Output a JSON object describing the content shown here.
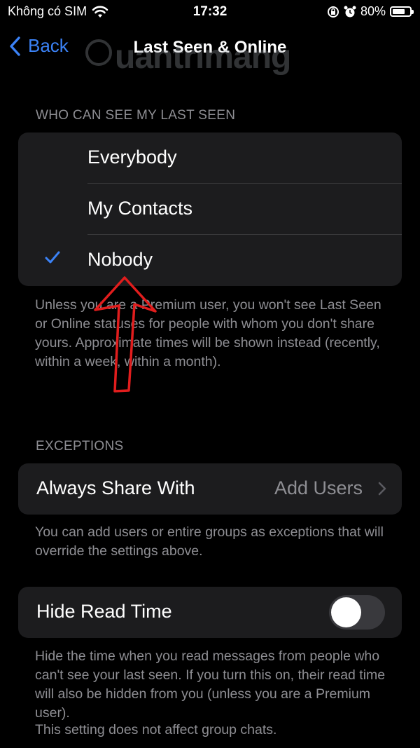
{
  "status_bar": {
    "carrier": "Không có SIM",
    "time": "17:32",
    "battery_percent": "80%",
    "battery_level": 0.8,
    "icons": [
      "wifi-icon",
      "orientation-lock-icon",
      "alarm-icon",
      "battery-icon"
    ]
  },
  "nav": {
    "back_label": "Back",
    "title": "Last Seen & Online"
  },
  "watermark": {
    "text": "uantrimang"
  },
  "last_seen": {
    "header": "WHO CAN SEE MY LAST SEEN",
    "options": [
      {
        "label": "Everybody",
        "selected": false
      },
      {
        "label": "My Contacts",
        "selected": false
      },
      {
        "label": "Nobody",
        "selected": true
      }
    ],
    "footer": "Unless you are a Premium user, you won't see Last Seen or Online statuses for people with whom you don't share yours. Approximate times will be shown instead (recently, within a week, within a month)."
  },
  "exceptions": {
    "header": "EXCEPTIONS",
    "row_label": "Always Share With",
    "row_value": "Add Users",
    "footer": "You can add users or entire groups as exceptions that will override the settings above."
  },
  "read_time": {
    "label": "Hide Read Time",
    "enabled": false,
    "footer": "Hide the time when you read messages from people who can't see your last seen. If you turn this on, their read time will also be hidden from you (unless you are a Premium user).",
    "footer2": "This setting does not affect group chats."
  },
  "colors": {
    "accent": "#3b82f6",
    "background": "#000000",
    "cell": "#1c1c1e",
    "secondary_text": "#8e8e93",
    "annotation": "#e11d1d"
  }
}
